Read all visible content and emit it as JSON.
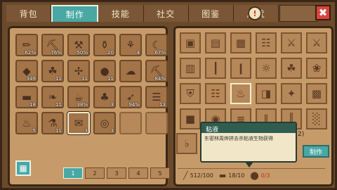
{
  "tabs": [
    {
      "label": "背包",
      "active": false
    },
    {
      "label": "制作",
      "active": true
    },
    {
      "label": "技能",
      "active": false
    },
    {
      "label": "社交",
      "active": false
    },
    {
      "label": "图鉴",
      "active": false
    },
    {
      "label": "成就",
      "active": false
    }
  ],
  "inventory": {
    "slots": [
      {
        "icon": "log",
        "glyph": "✏",
        "count": "62%"
      },
      {
        "icon": "pickaxe",
        "glyph": "⛏",
        "count": "76%"
      },
      {
        "icon": "hammer",
        "glyph": "⚒",
        "count": "50%"
      },
      {
        "icon": "jar",
        "glyph": "⚱",
        "count": "20"
      },
      {
        "icon": "tube",
        "glyph": "⚘",
        "count": "4"
      },
      {
        "icon": "sickle",
        "glyph": "☾",
        "count": "67%"
      },
      {
        "icon": "stone",
        "glyph": "◆",
        "count": "349"
      },
      {
        "icon": "herb",
        "glyph": "☘",
        "count": "11"
      },
      {
        "icon": "wood",
        "glyph": "✢",
        "count": "11"
      },
      {
        "icon": "meat",
        "glyph": "●",
        "count": "11"
      },
      {
        "icon": "wool",
        "glyph": "☁",
        "count": ""
      },
      {
        "icon": "axe",
        "glyph": "⛏",
        "count": "84%"
      },
      {
        "icon": "plank",
        "glyph": "▬",
        "count": "18"
      },
      {
        "icon": "feather",
        "glyph": "❧",
        "count": "11"
      },
      {
        "icon": "bucket",
        "glyph": "☕",
        "count": "38%"
      },
      {
        "icon": "mushroom",
        "glyph": "♣",
        "count": "3"
      },
      {
        "icon": "bow",
        "glyph": "➶",
        "count": "94%"
      },
      {
        "icon": "bandage",
        "glyph": "☰",
        "count": "13"
      },
      {
        "icon": "torch",
        "glyph": "♨",
        "count": "5"
      },
      {
        "icon": "potion",
        "glyph": "⚗",
        "count": "11"
      },
      {
        "icon": "parchment",
        "glyph": "✉",
        "count": "3"
      },
      {
        "icon": "pan",
        "glyph": "◎",
        "count": "3"
      },
      {
        "icon": "",
        "glyph": "",
        "count": ""
      },
      {
        "icon": "",
        "glyph": "",
        "count": ""
      }
    ],
    "selected_index": 20,
    "pages": [
      "1",
      "2",
      "3",
      "4",
      "5"
    ],
    "active_page": 0
  },
  "recipes": [
    {
      "icon": "chest",
      "glyph": "▣"
    },
    {
      "icon": "crate",
      "glyph": "▤"
    },
    {
      "icon": "carpet",
      "glyph": "▦"
    },
    {
      "icon": "bench",
      "glyph": "☷"
    },
    {
      "icon": "sword",
      "glyph": "⚔"
    },
    {
      "icon": "cross-sword",
      "glyph": "⚔"
    },
    {
      "icon": "cabinet",
      "glyph": "▥"
    },
    {
      "icon": "pillar",
      "glyph": "┃"
    },
    {
      "icon": "candle",
      "glyph": "❙"
    },
    {
      "icon": "lamp",
      "glyph": "☼"
    },
    {
      "icon": "pot",
      "glyph": "☘"
    },
    {
      "icon": "tree",
      "glyph": "❀"
    },
    {
      "icon": "armor",
      "glyph": "⛨"
    },
    {
      "icon": "machine",
      "glyph": "☷"
    },
    {
      "icon": "scroll-torch",
      "glyph": "♨"
    },
    {
      "icon": "wrap",
      "glyph": "◨"
    },
    {
      "icon": "star-shape",
      "glyph": "✦"
    },
    {
      "icon": "stone-plate",
      "glyph": "▩"
    },
    {
      "icon": "barrel",
      "glyph": "■"
    },
    {
      "icon": "pot-black",
      "glyph": "◉"
    },
    {
      "icon": "fence",
      "glyph": "≡"
    },
    {
      "icon": "rails",
      "glyph": "∥"
    },
    {
      "icon": "bars",
      "glyph": "║"
    },
    {
      "icon": "grate",
      "glyph": "░"
    }
  ],
  "recipe_selected_index": 14,
  "tooltip": {
    "title": "粘液",
    "desc": "东密林周烨拼去杀粘液生物获得"
  },
  "craft": {
    "qty_label": "2)",
    "make_label": "制作",
    "requirements": [
      {
        "icon": "log",
        "glyph": "╱",
        "value": "512/100",
        "short": false
      },
      {
        "icon": "plank",
        "glyph": "▬",
        "value": "18/10",
        "short": false
      },
      {
        "icon": "slime",
        "glyph": "⬤",
        "value": "0/3",
        "short": true
      }
    ]
  },
  "pin_icon_label": "!",
  "close_label": "✖"
}
